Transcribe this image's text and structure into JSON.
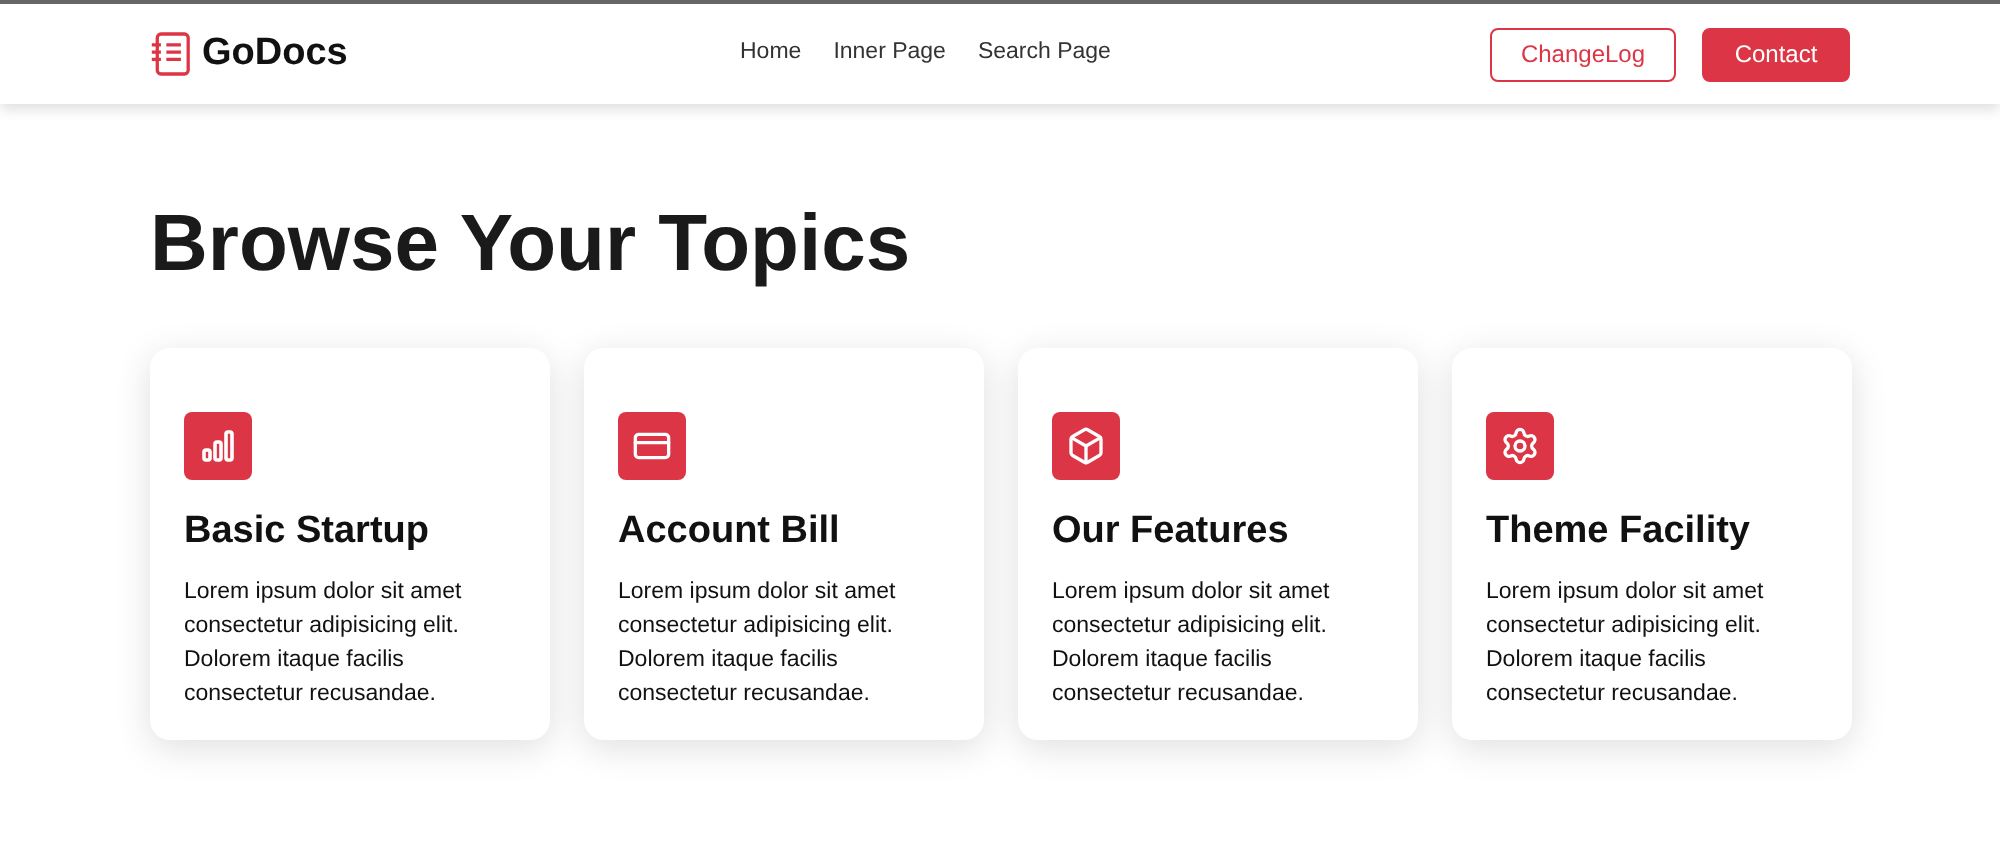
{
  "brand": {
    "name": "GoDocs"
  },
  "nav": [
    {
      "label": "Home"
    },
    {
      "label": "Inner Page"
    },
    {
      "label": "Search Page"
    }
  ],
  "buttons": [
    {
      "label": "ChangeLog",
      "kind": "outline"
    },
    {
      "label": "Contact",
      "kind": "solid"
    }
  ],
  "heading": "Browse Your Topics",
  "topics": [
    {
      "title": "Basic Startup",
      "text": "Lorem ipsum dolor sit amet consectetur adipisicing elit. Dolorem itaque facilis consectetur recusandae."
    },
    {
      "title": "Account Bill",
      "text": "Lorem ipsum dolor sit amet consectetur adipisicing elit. Dolorem itaque facilis consectetur recusandae."
    },
    {
      "title": "Our Features",
      "text": "Lorem ipsum dolor sit amet consectetur adipisicing elit. Dolorem itaque facilis consectetur recusandae."
    },
    {
      "title": "Theme Facility",
      "text": "Lorem ipsum dolor sit amet consectetur adipisicing elit. Dolorem itaque facilis consectetur recusandae."
    }
  ]
}
